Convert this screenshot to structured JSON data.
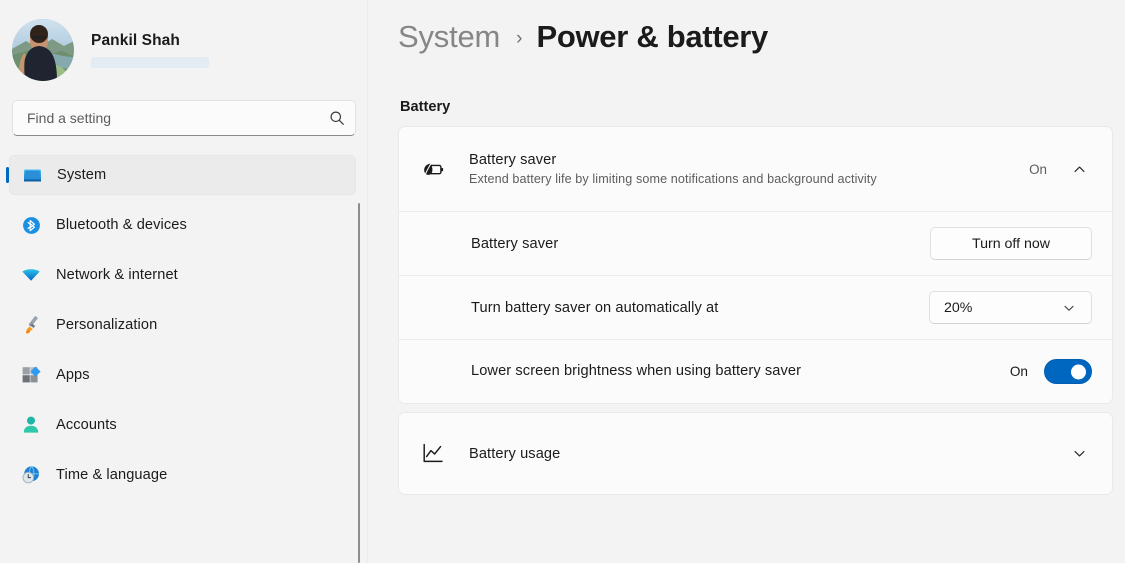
{
  "profile": {
    "name": "Pankil Shah",
    "avatar_icon": "user-photo-avatar"
  },
  "search": {
    "placeholder": "Find a setting",
    "value": "",
    "icon": "search-icon"
  },
  "sidebar": {
    "items": [
      {
        "label": "System",
        "icon": "monitor-icon",
        "selected": true
      },
      {
        "label": "Bluetooth & devices",
        "icon": "bluetooth-icon",
        "selected": false
      },
      {
        "label": "Network & internet",
        "icon": "wifi-icon",
        "selected": false
      },
      {
        "label": "Personalization",
        "icon": "paintbrush-icon",
        "selected": false
      },
      {
        "label": "Apps",
        "icon": "apps-grid-icon",
        "selected": false
      },
      {
        "label": "Accounts",
        "icon": "person-icon",
        "selected": false
      },
      {
        "label": "Time & language",
        "icon": "globe-clock-icon",
        "selected": false
      }
    ]
  },
  "header": {
    "parent": "System",
    "separator": "›",
    "current": "Power & battery"
  },
  "main": {
    "section_title": "Battery",
    "battery_saver": {
      "icon": "battery-saver-leaf-icon",
      "title": "Battery saver",
      "subtitle": "Extend battery life by limiting some notifications and background activity",
      "status": "On",
      "chevron": "chevron-up-icon",
      "rows": [
        {
          "title": "Battery saver",
          "control": "button",
          "button_label": "Turn off now"
        },
        {
          "title": "Turn battery saver on automatically at",
          "control": "select",
          "select_value": "20%",
          "select_chevron": "chevron-down-icon"
        },
        {
          "title": "Lower screen brightness when using battery saver",
          "control": "toggle",
          "toggle_label": "On",
          "toggle_state": "on"
        }
      ]
    },
    "battery_usage": {
      "icon": "line-chart-icon",
      "title": "Battery usage",
      "chevron": "chevron-down-icon"
    }
  },
  "colors": {
    "accent": "#0067c0",
    "page_background": "#f3f3f3",
    "card_background": "#fbfbfb"
  }
}
